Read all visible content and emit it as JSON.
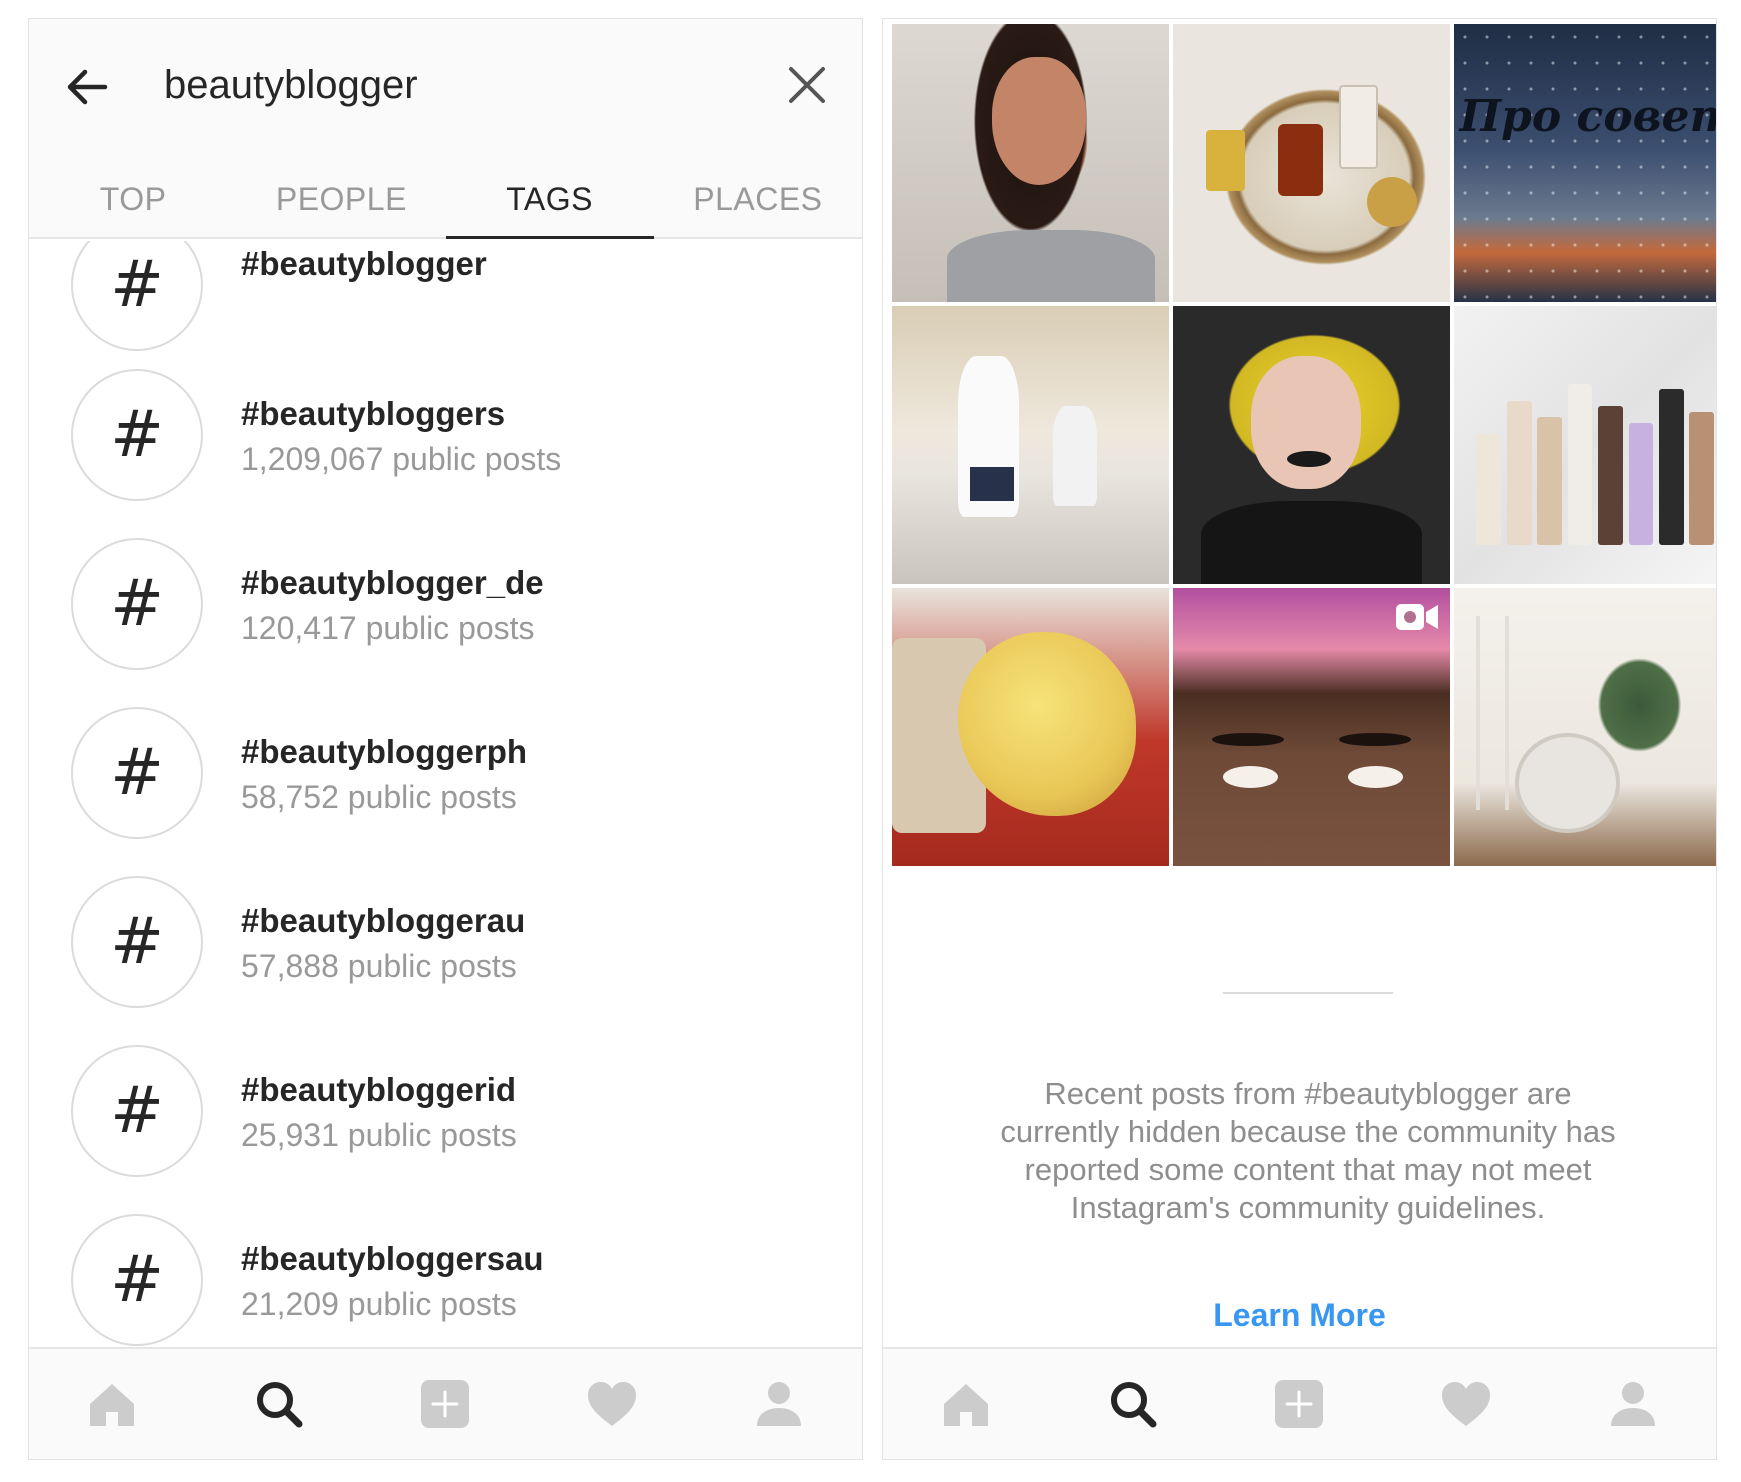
{
  "search": {
    "query": "beautyblogger"
  },
  "tabs": [
    {
      "label": "TOP"
    },
    {
      "label": "PEOPLE"
    },
    {
      "label": "TAGS"
    },
    {
      "label": "PLACES"
    }
  ],
  "active_tab": "TAGS",
  "tags": [
    {
      "name": "#beautyblogger",
      "count": ""
    },
    {
      "name": "#beautybloggers",
      "count": "1,209,067 public posts"
    },
    {
      "name": "#beautyblogger_de",
      "count": "120,417 public posts"
    },
    {
      "name": "#beautybloggerph",
      "count": "58,752 public posts"
    },
    {
      "name": "#beautybloggerau",
      "count": "57,888 public posts"
    },
    {
      "name": "#beautybloggerid",
      "count": "25,931 public posts"
    },
    {
      "name": "#beautybloggersau",
      "count": "21,209 public posts"
    }
  ],
  "hash_symbol": "#",
  "grid": {
    "overlay_text": "Про советы"
  },
  "notice": {
    "text": "Recent posts from #beautyblogger are currently hidden because the community has reported some content that may not meet Instagram's community guidelines.",
    "link": "Learn More"
  },
  "nav": {
    "icons": [
      "home-icon",
      "search-icon",
      "add-post-icon",
      "heart-icon",
      "profile-icon"
    ],
    "active": "search-icon"
  },
  "colors": {
    "link_blue": "#3897f0",
    "text_dark": "#262626",
    "text_gray": "#999999",
    "icon_inactive": "#cccccc"
  }
}
